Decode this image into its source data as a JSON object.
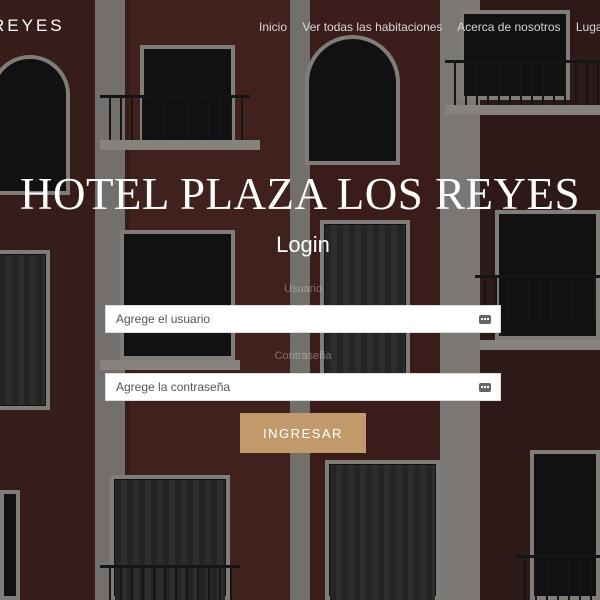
{
  "nav": {
    "brand": "REYES",
    "links": [
      "Inicio",
      "Ver todas las habitaciones",
      "Acerca de nosotros",
      "Lugares a"
    ]
  },
  "hero": {
    "title": "HOTEL PLAZA LOS REYES"
  },
  "login": {
    "title": "Login",
    "user_label": "Usuario",
    "user_placeholder": "Agrege el usuario",
    "pass_label": "Contraseña",
    "pass_placeholder": "Agrege la contraseña",
    "submit_label": "INGRESAR"
  },
  "colors": {
    "accent": "#c19a6b"
  }
}
